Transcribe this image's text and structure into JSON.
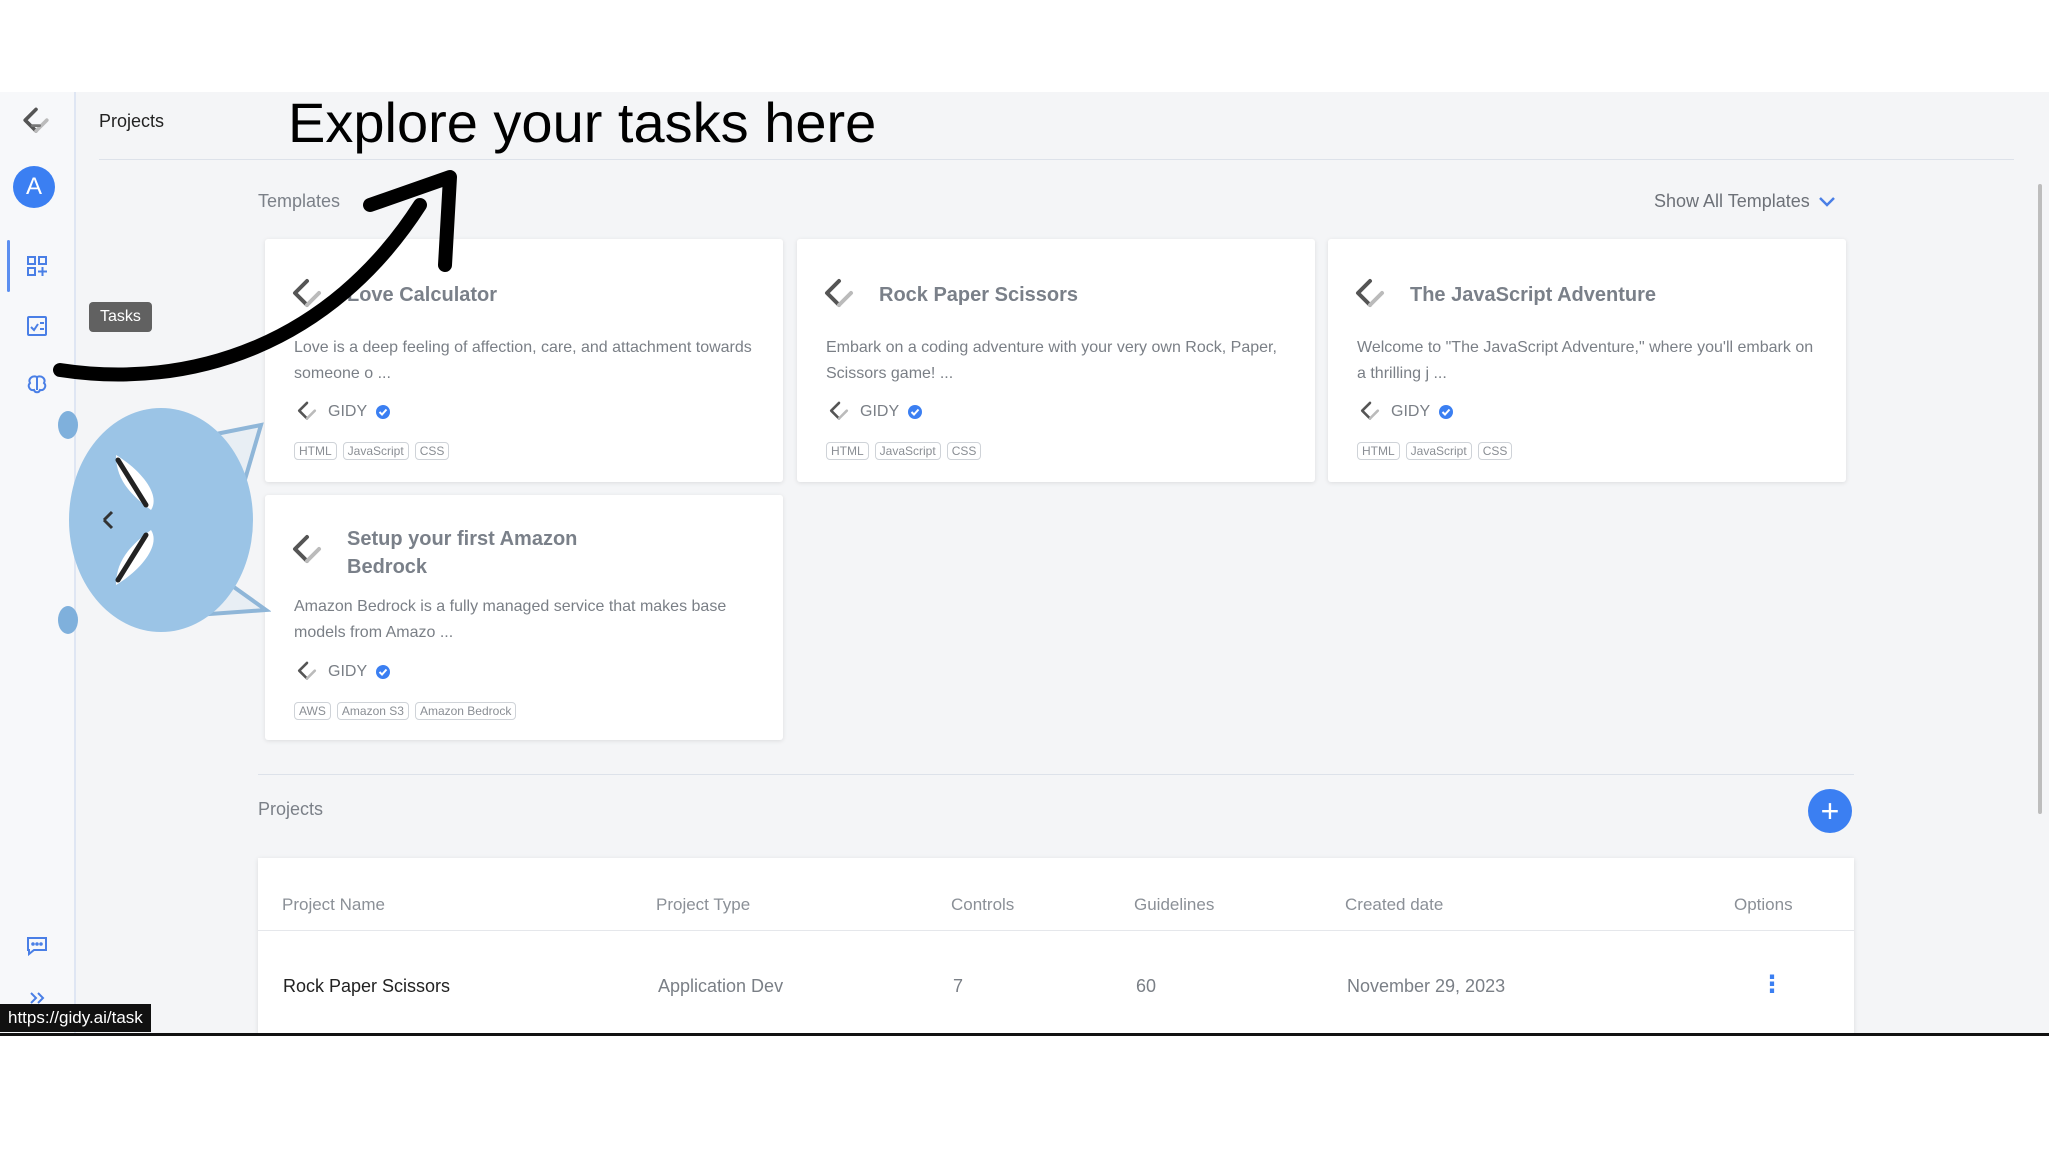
{
  "overlay": {
    "headline": "Explore your tasks here"
  },
  "sidebar": {
    "avatar_letter": "A",
    "tooltip": "Tasks",
    "icons": [
      "gidy-logo-icon",
      "dashboard-icon",
      "tasks-icon",
      "brain-icon",
      "chat-icon",
      "expand-icon"
    ]
  },
  "header": {
    "title": "Projects"
  },
  "templates": {
    "section_label": "Templates",
    "show_all_label": "Show All Templates",
    "cards": [
      {
        "title": "Love Calculator",
        "description": "Love is a deep feeling of affection, care, and attachment towards someone o ...",
        "owner": "GIDY",
        "tags": [
          "HTML",
          "JavaScript",
          "CSS"
        ]
      },
      {
        "title": "Rock Paper Scissors",
        "description": "Embark on a coding adventure with your very own Rock, Paper, Scissors game! ...",
        "owner": "GIDY",
        "tags": [
          "HTML",
          "JavaScript",
          "CSS"
        ]
      },
      {
        "title": "The JavaScript Adventure",
        "description": "Welcome to \"The JavaScript Adventure,\" where you'll embark on a thrilling j ...",
        "owner": "GIDY",
        "tags": [
          "HTML",
          "JavaScript",
          "CSS"
        ]
      },
      {
        "title": "Setup your first Amazon Bedrock",
        "description": "Amazon Bedrock is a fully managed service that makes base models from Amazo ...",
        "owner": "GIDY",
        "tags": [
          "AWS",
          "Amazon S3",
          "Amazon Bedrock"
        ]
      }
    ]
  },
  "projects": {
    "section_label": "Projects",
    "add_label": "+",
    "columns": [
      "Project Name",
      "Project Type",
      "Controls",
      "Guidelines",
      "Created date",
      "Options"
    ],
    "rows": [
      {
        "name": "Rock Paper Scissors",
        "type": "Application Dev",
        "controls": "7",
        "guidelines": "60",
        "created": "November 29, 2023",
        "options": "⋮"
      }
    ]
  },
  "status_bar": {
    "url": "https://gidy.ai/task"
  },
  "colors": {
    "accent": "#3b7ff2",
    "page_bg": "#f4f5f7",
    "card_bg": "#ffffff"
  }
}
